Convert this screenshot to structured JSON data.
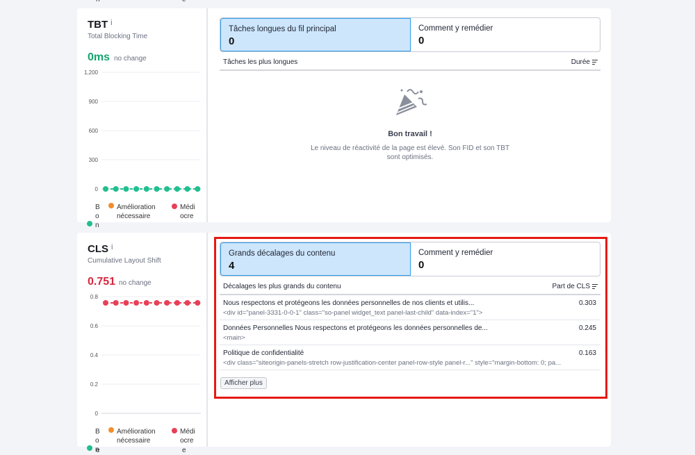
{
  "stray": {
    "n": "n",
    "e": "e"
  },
  "legend": {
    "good": "Bon",
    "needs": "Amélioration",
    "needs2": "nécessaire",
    "poor": "Médiocre"
  },
  "tbt": {
    "title": "TBT",
    "info": "i",
    "subtitle": "Total Blocking Time",
    "value": "0ms",
    "change": "no change",
    "y_ticks": [
      "1,200",
      "900",
      "600",
      "300",
      "0"
    ],
    "tabs": [
      {
        "label": "Tâches longues du fil principal",
        "count": "0"
      },
      {
        "label": "Comment y remédier",
        "count": "0"
      }
    ],
    "list_header": "Tâches les plus longues",
    "sort_label": "Durée",
    "empty_title": "Bon travail !",
    "empty_text": "Le niveau de réactivité de la page est élevé. Son FID et son TBT sont optimisés."
  },
  "cls": {
    "title": "CLS",
    "info": "i",
    "subtitle": "Cumulative Layout Shift",
    "value": "0.751",
    "change": "no change",
    "y_ticks": [
      "0.8",
      "0.6",
      "0.4",
      "0.2",
      "0"
    ],
    "tabs": [
      {
        "label": "Grands décalages du contenu",
        "count": "4"
      },
      {
        "label": "Comment y remédier",
        "count": "0"
      }
    ],
    "list_header": "Décalages les plus grands du contenu",
    "sort_label": "Part de CLS",
    "rows": [
      {
        "title": "Nous respectons et protégeons les données personnelles de nos clients et utilis...",
        "code": "<div id=\"panel-3331-0-0-1\" class=\"so-panel widget_text panel-last-child\" data-index=\"1\">",
        "value": "0.303"
      },
      {
        "title": "Données Personnelles Nous respectons et protégeons les données personnelles de...",
        "code": "<main>",
        "value": "0.245"
      },
      {
        "title": "Politique de confidentialité",
        "code": "<div class=\"siteorigin-panels-stretch row-justification-center panel-row-style panel-r...\" style=\"margin-bottom: 0; pa...",
        "value": "0.163"
      }
    ],
    "more_label": "Afficher plus"
  },
  "colors": {
    "good": "#1fbf8f",
    "needs": "#f28e2b",
    "poor": "#e84057",
    "active_tab": "#cde6fb",
    "highlight": "#e51a12"
  }
}
